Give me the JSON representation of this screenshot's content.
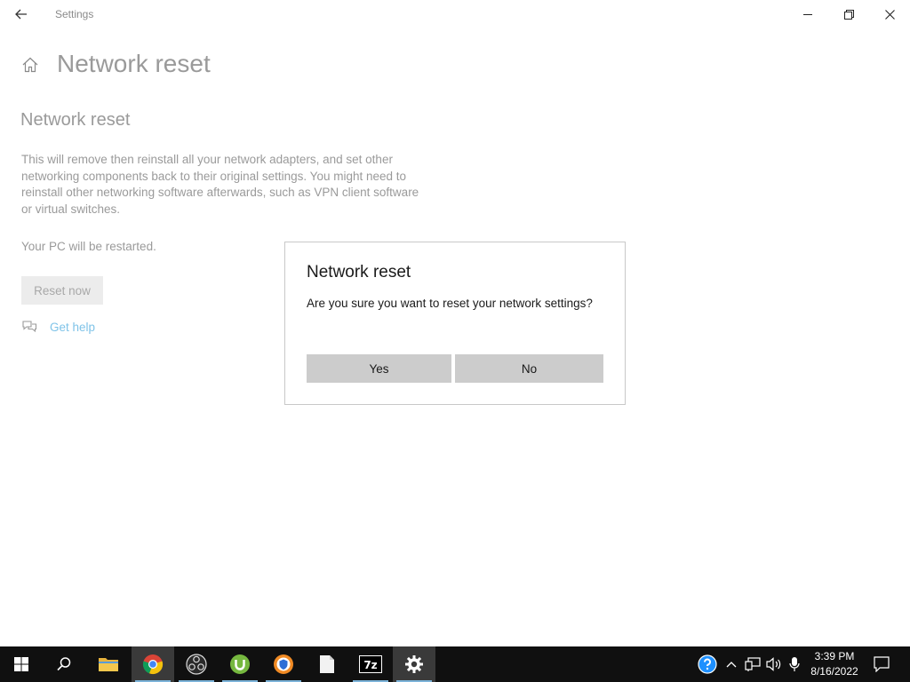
{
  "window": {
    "title": "Settings"
  },
  "page": {
    "title": "Network reset"
  },
  "content": {
    "section_title": "Network reset",
    "description": "This will remove then reinstall all your network adapters, and set other networking components back to their original settings. You might need to reinstall other networking software afterwards, such as VPN client software or virtual switches.",
    "restart_note": "Your PC will be restarted.",
    "reset_button": "Reset now",
    "help_link": "Get help"
  },
  "dialog": {
    "title": "Network reset",
    "message": "Are you sure you want to reset your network settings?",
    "yes_label": "Yes",
    "no_label": "No"
  },
  "taskbar": {
    "apps": [
      {
        "name": "start",
        "icon": "windows-logo-icon"
      },
      {
        "name": "search",
        "icon": "search-icon"
      },
      {
        "name": "file-explorer",
        "icon": "folder-icon"
      },
      {
        "name": "chrome",
        "icon": "chrome-icon"
      },
      {
        "name": "obs",
        "icon": "obs-icon"
      },
      {
        "name": "utorrent",
        "icon": "utorrent-icon"
      },
      {
        "name": "avast-browser",
        "icon": "shield-browser-icon"
      },
      {
        "name": "notepad",
        "icon": "document-icon"
      },
      {
        "name": "7zip",
        "icon": "7zip-icon",
        "label": "7z"
      },
      {
        "name": "settings",
        "icon": "gear-icon",
        "active": true
      }
    ],
    "time": "3:39 PM",
    "date": "8/16/2022"
  },
  "colors": {
    "taskbar_bg": "#101010",
    "dialog_button": "#cccccc",
    "link": "#7fc3e8",
    "disabled_text": "#9a9a9a"
  }
}
